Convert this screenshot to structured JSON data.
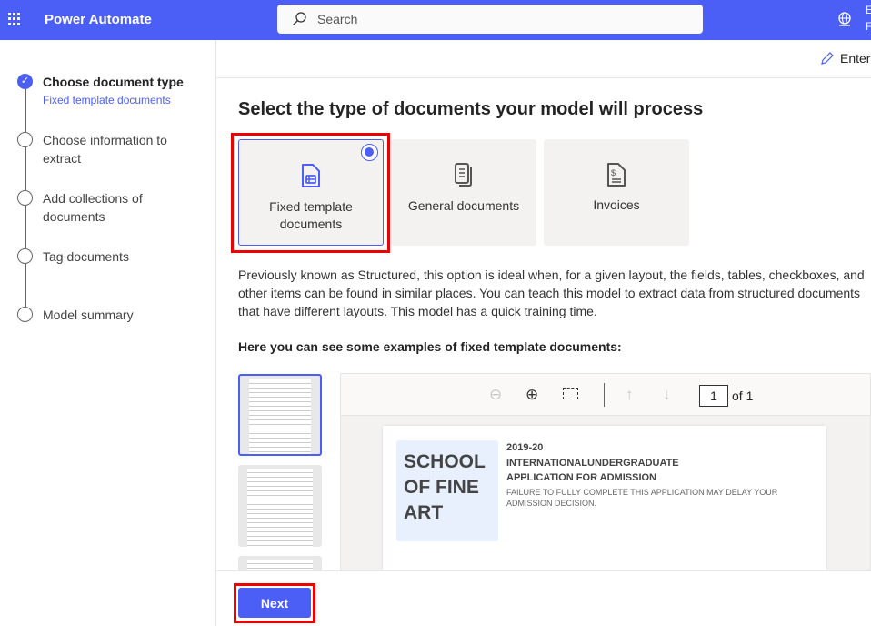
{
  "header": {
    "app_title": "Power Automate",
    "search_placeholder": "Search",
    "env_line1": "E",
    "env_line2": "F"
  },
  "sidebar": {
    "steps": [
      {
        "label": "Choose document type",
        "sub": "Fixed template documents",
        "done": true
      },
      {
        "label": "Choose information to extract"
      },
      {
        "label": "Add collections of documents"
      },
      {
        "label": "Tag documents"
      },
      {
        "label": "Model summary"
      }
    ]
  },
  "topbar": {
    "enter_label": "Enter"
  },
  "main": {
    "title": "Select the type of documents your model will process",
    "cards": [
      {
        "label": "Fixed template documents",
        "selected": true
      },
      {
        "label": "General documents"
      },
      {
        "label": "Invoices"
      }
    ],
    "description": "Previously known as Structured, this option is ideal when, for a given layout, the fields, tables, checkboxes, and other items can be found in similar places. You can teach this model to extract data from structured documents that have different layouts. This model has a quick training time.",
    "examples_heading": "Here you can see some examples of fixed template documents:",
    "viewer": {
      "page": "1",
      "of_label": "of 1",
      "doc": {
        "logo_line1": "SCHOOL",
        "logo_line2": "OF FINE",
        "logo_line3": "ART",
        "year": "2019-20",
        "line1": "INTERNATIONALUNDERGRADUATE",
        "line2": "APPLICATION FOR ADMISSION",
        "note": "FAILURE TO FULLY COMPLETE THIS APPLICATION MAY DELAY YOUR ADMISSION DECISION."
      }
    }
  },
  "footer": {
    "next_label": "Next"
  },
  "colors": {
    "brand": "#4b5ff6",
    "highlight": "#e00000"
  }
}
